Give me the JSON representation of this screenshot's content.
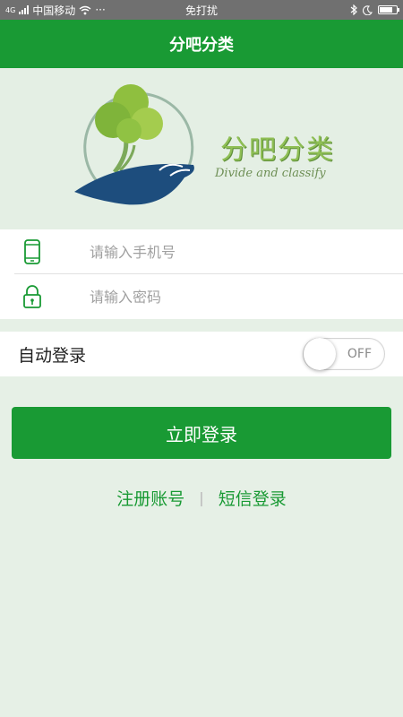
{
  "status_bar": {
    "network": "4G",
    "carrier": "中国移动",
    "more": "···",
    "center": "免打扰"
  },
  "title": "分吧分类",
  "logo": {
    "title": "分吧分类",
    "subtitle": "Divide and classify"
  },
  "form": {
    "phone_placeholder": "请输入手机号",
    "password_placeholder": "请输入密码"
  },
  "auto_login": {
    "label": "自动登录",
    "toggle_state": "OFF"
  },
  "login_button": "立即登录",
  "links": {
    "register": "注册账号",
    "separator": "|",
    "sms_login": "短信登录"
  },
  "colors": {
    "primary": "#199a34",
    "background": "#e6f0e6"
  },
  "icons": [
    "wifi-icon",
    "bluetooth-icon",
    "moon-icon",
    "battery-icon",
    "phone-icon",
    "lock-icon"
  ]
}
